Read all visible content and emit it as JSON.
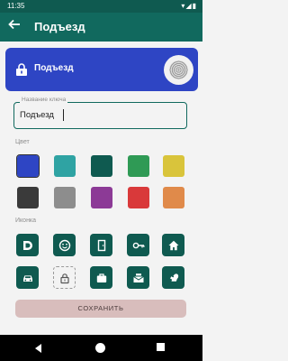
{
  "status": {
    "time": "11:35",
    "icons": "▾◢▮"
  },
  "appbar": {
    "title": "Подъезд",
    "back_icon": "arrow-left-icon"
  },
  "card": {
    "name": "Подъезд",
    "color": "#2e45c4"
  },
  "name_field": {
    "label": "Название ключа",
    "value": "Подъезд"
  },
  "color_section": {
    "label": "Цвет"
  },
  "colors": [
    "#2e45c4",
    "#2fa3a3",
    "#0f5a50",
    "#2f9a55",
    "#d9c43b",
    "#3a3a3a",
    "#8d8d8d",
    "#8c3a96",
    "#d9393a",
    "#e08a4a"
  ],
  "selected_color": "#2e45c4",
  "icon_section": {
    "label": "Иконка"
  },
  "icons": [
    "d-logo-icon",
    "smiley-icon",
    "door-icon",
    "key-icon",
    "home-icon",
    "car-icon",
    "lock-icon",
    "briefcase-icon",
    "mailbox-icon",
    "squirrel-icon"
  ],
  "selected_icon": "lock-icon",
  "save_label": "СОХРАНИТЬ"
}
